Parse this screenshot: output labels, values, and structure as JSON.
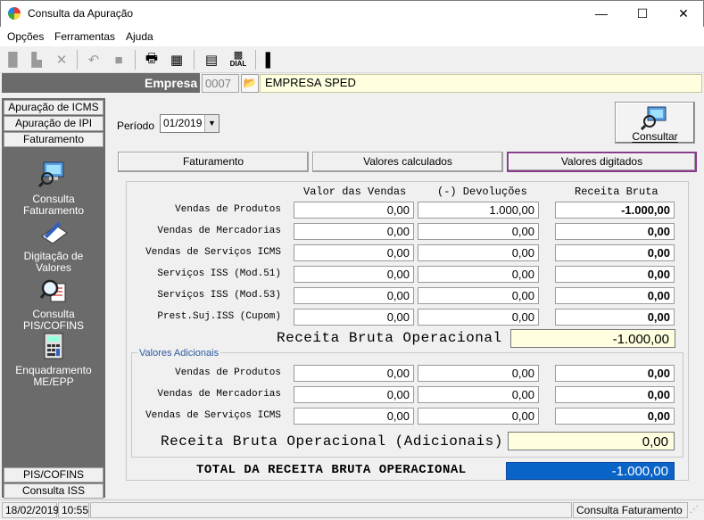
{
  "window": {
    "title": "Consulta da Apuração",
    "minimize": "—",
    "maximize": "☐",
    "close": "✕"
  },
  "menu": {
    "opcoes": "Opções",
    "ferramentas": "Ferramentas",
    "ajuda": "Ajuda"
  },
  "toolbar": {
    "dial_label": "DIAL"
  },
  "empresa": {
    "label": "Empresa",
    "code": "0007",
    "name": "EMPRESA SPED"
  },
  "sidebar": {
    "tabs_top": [
      "Apuração de ICMS",
      "Apuração de IPI",
      "Faturamento"
    ],
    "items": [
      {
        "label_line1": "Consulta",
        "label_line2": "Faturamento",
        "icon": "monitor-magnifier-icon"
      },
      {
        "label_line1": "Digitação de",
        "label_line2": "Valores",
        "icon": "pencil-note-icon"
      },
      {
        "label_line1": "Consulta",
        "label_line2": "PIS/COFINS",
        "icon": "magnifier-document-icon"
      },
      {
        "label_line1": "Enquadramento",
        "label_line2": "ME/EPP",
        "icon": "calculator-icon"
      }
    ],
    "tabs_bottom": [
      "PIS/COFINS",
      "Consulta ISS"
    ]
  },
  "periodo": {
    "label": "Período",
    "value": "01/2019"
  },
  "consultar": {
    "label": "Consultar"
  },
  "tabs": {
    "faturamento": "Faturamento",
    "valores_calculados": "Valores calculados",
    "valores_digitados": "Valores digitados"
  },
  "grid": {
    "headers": {
      "valor_vendas": "Valor das Vendas",
      "devolucoes": "(-) Devoluções",
      "receita_bruta": "Receita Bruta"
    },
    "rows": [
      {
        "label": "Vendas de Produtos",
        "vendas": "0,00",
        "devol": "1.000,00",
        "receita": "-1.000,00"
      },
      {
        "label": "Vendas de Mercadorias",
        "vendas": "0,00",
        "devol": "0,00",
        "receita": "0,00"
      },
      {
        "label": "Vendas de Serviços ICMS",
        "vendas": "0,00",
        "devol": "0,00",
        "receita": "0,00"
      },
      {
        "label": "Serviços ISS (Mod.51)",
        "vendas": "0,00",
        "devol": "0,00",
        "receita": "0,00"
      },
      {
        "label": "Serviços ISS (Mod.53)",
        "vendas": "0,00",
        "devol": "0,00",
        "receita": "0,00"
      },
      {
        "label": "Prest.Suj.ISS (Cupom)",
        "vendas": "0,00",
        "devol": "0,00",
        "receita": "0,00"
      }
    ],
    "rbo_label": "Receita Bruta Operacional",
    "rbo_value": "-1.000,00"
  },
  "adicionais": {
    "legend": "Valores Adicionais",
    "rows": [
      {
        "label": "Vendas de Produtos",
        "vendas": "0,00",
        "devol": "0,00",
        "receita": "0,00"
      },
      {
        "label": "Vendas de Mercadorias",
        "vendas": "0,00",
        "devol": "0,00",
        "receita": "0,00"
      },
      {
        "label": "Vendas de Serviços ICMS",
        "vendas": "0,00",
        "devol": "0,00",
        "receita": "0,00"
      }
    ],
    "rboa_label": "Receita Bruta Operacional (Adicionais)",
    "rboa_value": "0,00"
  },
  "total": {
    "label": "TOTAL DA RECEITA BRUTA OPERACIONAL",
    "value": "-1.000,00"
  },
  "status": {
    "date": "18/02/2019",
    "time": "10:55",
    "screen": "Consulta Faturamento"
  },
  "colors": {
    "total_bg": "#0a64c8",
    "yellow_bg": "#ffffe0",
    "active_tab_border": "#8a3c8c",
    "sidebar_bg": "#6b6b6b"
  }
}
